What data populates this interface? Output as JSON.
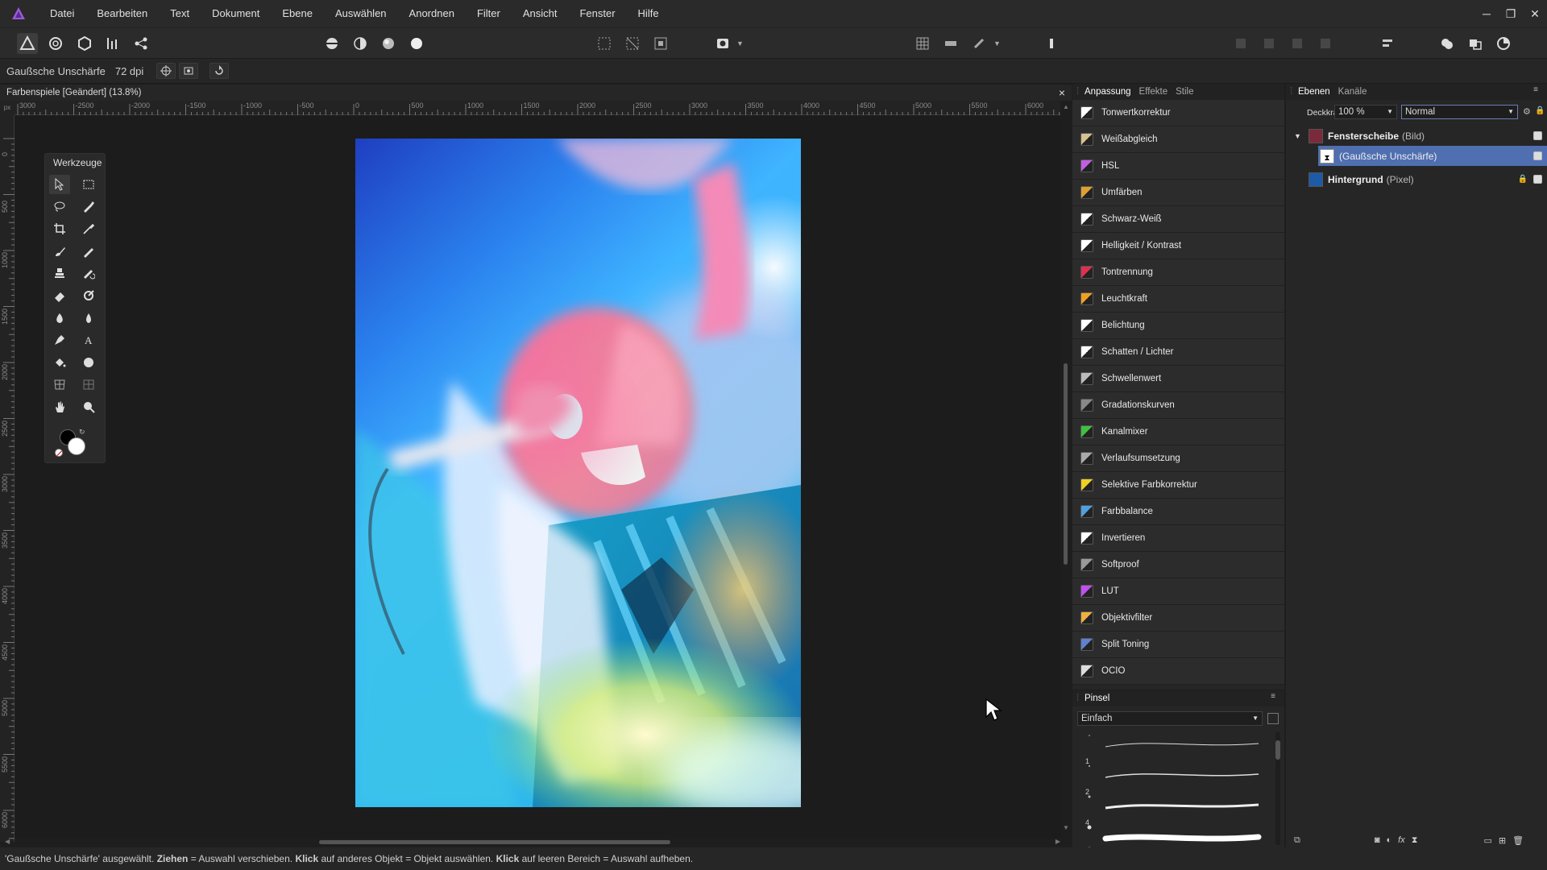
{
  "menu": [
    "Datei",
    "Bearbeiten",
    "Text",
    "Dokument",
    "Ebene",
    "Auswählen",
    "Anordnen",
    "Filter",
    "Ansicht",
    "Fenster",
    "Hilfe"
  ],
  "context": {
    "tool_name": "Gaußsche Unschärfe",
    "dpi": "72 dpi"
  },
  "document": {
    "tab_title": "Farbenspiele [Geändert] (13.8%)",
    "close": "×"
  },
  "ruler": {
    "h_labels": [
      "3000",
      "-2500",
      "-2000",
      "-1500",
      "-1000",
      "-500",
      "0",
      "500",
      "1000",
      "1500",
      "2000",
      "2500",
      "3000",
      "3500",
      "4000",
      "4500",
      "5000",
      "5500",
      "6000"
    ],
    "v_labels": [
      "0",
      "500",
      "1000",
      "1500",
      "2000",
      "2500",
      "3000",
      "3500",
      "4000",
      "4500",
      "5000",
      "5500",
      "6000"
    ]
  },
  "tools": {
    "title": "Werkzeuge"
  },
  "adjustments": {
    "tabs": [
      "Anpassung",
      "Effekte",
      "Stile"
    ],
    "items": [
      {
        "label": "Tonwertkorrektur",
        "icon": "levels-icon",
        "color": "#ffffff"
      },
      {
        "label": "Weißabgleich",
        "icon": "white-balance-icon",
        "color": "#d8c090"
      },
      {
        "label": "HSL",
        "icon": "hsl-icon",
        "color": "#c060e0"
      },
      {
        "label": "Umfärben",
        "icon": "recolor-icon",
        "color": "#e0a030"
      },
      {
        "label": "Schwarz-Weiß",
        "icon": "black-white-icon",
        "color": "#ffffff"
      },
      {
        "label": "Helligkeit / Kontrast",
        "icon": "brightness-contrast-icon",
        "color": "#ffffff"
      },
      {
        "label": "Tontrennung",
        "icon": "posterize-icon",
        "color": "#e03050"
      },
      {
        "label": "Leuchtkraft",
        "icon": "vibrance-icon",
        "color": "#f0a020"
      },
      {
        "label": "Belichtung",
        "icon": "exposure-icon",
        "color": "#ffffff"
      },
      {
        "label": "Schatten / Lichter",
        "icon": "shadows-highlights-icon",
        "color": "#ffffff"
      },
      {
        "label": "Schwellenwert",
        "icon": "threshold-icon",
        "color": "#bbbbbb"
      },
      {
        "label": "Gradationskurven",
        "icon": "curves-icon",
        "color": "#888888"
      },
      {
        "label": "Kanalmixer",
        "icon": "channel-mixer-icon",
        "color": "#40c040"
      },
      {
        "label": "Verlaufsumsetzung",
        "icon": "gradient-map-icon",
        "color": "#aaaaaa"
      },
      {
        "label": "Selektive Farbkorrektur",
        "icon": "selective-color-icon",
        "color": "#f0d020"
      },
      {
        "label": "Farbbalance",
        "icon": "color-balance-icon",
        "color": "#50a0e0"
      },
      {
        "label": "Invertieren",
        "icon": "invert-icon",
        "color": "#ffffff"
      },
      {
        "label": "Softproof",
        "icon": "soft-proof-icon",
        "color": "#999999"
      },
      {
        "label": "LUT",
        "icon": "lut-icon",
        "color": "#c050f0"
      },
      {
        "label": "Objektivfilter",
        "icon": "lens-filter-icon",
        "color": "#f0b040"
      },
      {
        "label": "Split Toning",
        "icon": "split-toning-icon",
        "color": "#6080d0"
      },
      {
        "label": "OCIO",
        "icon": "ocio-icon",
        "color": "#dddddd"
      }
    ]
  },
  "brushes": {
    "tab": "Pinsel",
    "category": "Einfach",
    "sizes": [
      "1",
      "2",
      "4"
    ]
  },
  "layers": {
    "tabs": [
      "Ebenen",
      "Kanäle"
    ],
    "opacity_label": "Deckkraft:",
    "opacity_value": "100 %",
    "blend_mode": "Normal",
    "items": [
      {
        "name": "Fensterscheibe",
        "type": "(Bild)"
      },
      {
        "name": "(Gaußsche Unschärfe)",
        "type": ""
      },
      {
        "name": "Hintergrund",
        "type": "(Pixel)"
      }
    ]
  },
  "status": {
    "parts": [
      {
        "t": "'Gaußsche Unschärfe' ausgewählt. ",
        "b": false
      },
      {
        "t": "Ziehen",
        "b": true
      },
      {
        "t": " = Auswahl verschieben. ",
        "b": false
      },
      {
        "t": "Klick",
        "b": true
      },
      {
        "t": " auf anderes Objekt = Objekt auswählen. ",
        "b": false
      },
      {
        "t": "Klick",
        "b": true
      },
      {
        "t": " auf leeren Bereich = Auswahl aufheben.",
        "b": false
      }
    ]
  },
  "colors": {
    "accent": "#4a78c8",
    "selection": "#4f6fb0",
    "bg": "#1e1e1e",
    "panel": "#262626"
  }
}
